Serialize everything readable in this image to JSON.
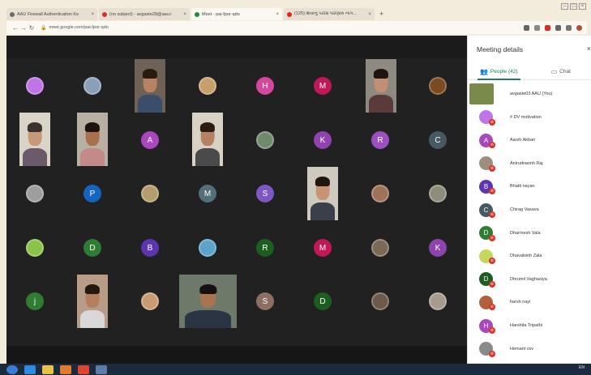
{
  "browser": {
    "tabs": [
      {
        "label": "AAU Firewall Authentication Ke",
        "icon": "globe-icon",
        "color": "#6b6b6b",
        "active": false
      },
      {
        "label": "(no subject) - avgaste28@aau.i",
        "icon": "gmail-icon",
        "color": "#d93025",
        "active": false
      },
      {
        "label": "Meet - pai-fpor-qdo",
        "icon": "meet-icon",
        "color": "#1e8e3e",
        "active": true
      },
      {
        "label": "(125) શિવાનુ પરીક્ષ પરિણામ નાગ...",
        "icon": "youtube-icon",
        "color": "#e62117",
        "active": false
      }
    ],
    "new_tab": "+",
    "window_controls": [
      "–",
      "□",
      "×"
    ],
    "url": "meet.google.com/pai-fpor-qdo"
  },
  "stage": {
    "avatars": [
      {
        "letter": "",
        "color": "#c074e6",
        "row": 0,
        "col": 0,
        "kind": "image"
      },
      {
        "letter": "",
        "color": "#8aa0b8",
        "row": 0,
        "col": 1,
        "kind": "image"
      },
      {
        "letter": "H",
        "color": "#d6479e",
        "row": 0,
        "col": 4
      },
      {
        "letter": "M",
        "color": "#c2185b",
        "row": 0,
        "col": 5
      },
      {
        "letter": "",
        "color": "#c8a06a",
        "row": 0,
        "col": 3,
        "kind": "image"
      },
      {
        "letter": "",
        "color": "#7b4a1f",
        "row": 0,
        "col": 7,
        "kind": "image"
      },
      {
        "letter": "A",
        "color": "#ab47bc",
        "row": 1,
        "col": 2
      },
      {
        "letter": "",
        "color": "#6f8a6c",
        "row": 1,
        "col": 4,
        "kind": "image"
      },
      {
        "letter": "K",
        "color": "#8e44ad",
        "row": 1,
        "col": 5
      },
      {
        "letter": "R",
        "color": "#9c4fbf",
        "row": 1,
        "col": 6
      },
      {
        "letter": "C",
        "color": "#455a64",
        "row": 1,
        "col": 7
      },
      {
        "letter": "",
        "color": "#9e9e9e",
        "row": 2,
        "col": 0,
        "kind": "image"
      },
      {
        "letter": "P",
        "color": "#1565c0",
        "row": 2,
        "col": 1
      },
      {
        "letter": "",
        "color": "#b59d6d",
        "row": 2,
        "col": 2,
        "kind": "image"
      },
      {
        "letter": "M",
        "color": "#546e7a",
        "row": 2,
        "col": 3
      },
      {
        "letter": "S",
        "color": "#7e57c2",
        "row": 2,
        "col": 4
      },
      {
        "letter": "",
        "color": "#a0725a",
        "row": 2,
        "col": 6,
        "kind": "image"
      },
      {
        "letter": "",
        "color": "#8d8d7a",
        "row": 2,
        "col": 7,
        "kind": "image"
      },
      {
        "letter": "",
        "color": "#8bc34a",
        "row": 3,
        "col": 0,
        "kind": "image"
      },
      {
        "letter": "D",
        "color": "#2e7d32",
        "row": 3,
        "col": 1
      },
      {
        "letter": "B",
        "color": "#5e35b1",
        "row": 3,
        "col": 2
      },
      {
        "letter": "",
        "color": "#5aa3c9",
        "row": 3,
        "col": 3,
        "kind": "image"
      },
      {
        "letter": "R",
        "color": "#1b5e20",
        "row": 3,
        "col": 4
      },
      {
        "letter": "M",
        "color": "#c2185b",
        "row": 3,
        "col": 5
      },
      {
        "letter": "",
        "color": "#7a6a55",
        "row": 3,
        "col": 6,
        "kind": "image"
      },
      {
        "letter": "K",
        "color": "#8e44ad",
        "row": 3,
        "col": 7
      },
      {
        "letter": "j",
        "color": "#2e7d32",
        "row": 4,
        "col": 0
      },
      {
        "letter": "",
        "color": "#c99b73",
        "row": 4,
        "col": 2,
        "kind": "image"
      },
      {
        "letter": "S",
        "color": "#8d6e63",
        "row": 4,
        "col": 4
      },
      {
        "letter": "D",
        "color": "#1b5e20",
        "row": 4,
        "col": 5
      },
      {
        "letter": "",
        "color": "#6e5a4a",
        "row": 4,
        "col": 6,
        "kind": "image"
      },
      {
        "letter": "",
        "color": "#a79b8c",
        "row": 4,
        "col": 7,
        "kind": "image"
      }
    ]
  },
  "panel": {
    "title": "Meeting details",
    "close": "×",
    "tabs": [
      {
        "label": "People (42)",
        "icon": "people-icon",
        "active": true
      },
      {
        "label": "Chat",
        "icon": "chat-icon",
        "active": false
      }
    ],
    "people": [
      {
        "name": "avgaste03 AAU (You)",
        "letter": "",
        "color": "#7a8a4a",
        "self": true
      },
      {
        "name": "# DV motivation",
        "letter": "",
        "color": "#c074e6"
      },
      {
        "name": "Aarsh Akbari",
        "letter": "A",
        "color": "#ab47bc"
      },
      {
        "name": "Anirudrasinh Raj",
        "letter": "",
        "color": "#9e8e7e"
      },
      {
        "name": "Bhatti nayan",
        "letter": "B",
        "color": "#5e35b1"
      },
      {
        "name": "Chirag Vasava",
        "letter": "C",
        "color": "#455a64"
      },
      {
        "name": "Dharmesh Vala",
        "letter": "D",
        "color": "#2e7d32"
      },
      {
        "name": "Dhavalsinh Zala",
        "letter": "",
        "color": "#c5d85a"
      },
      {
        "name": "Dhrumil Vaghasiya",
        "letter": "D",
        "color": "#1b5e20"
      },
      {
        "name": "harsh nayi",
        "letter": "",
        "color": "#b0603a"
      },
      {
        "name": "Harshita Tripathi",
        "letter": "H",
        "color": "#ab47bc"
      },
      {
        "name": "Hemant vsv",
        "letter": "",
        "color": "#8a8a8a"
      }
    ]
  },
  "taskbar": {
    "icons": [
      {
        "name": "start-icon",
        "color": "#3a7bd5"
      },
      {
        "name": "ie-icon",
        "color": "#2d8ce0"
      },
      {
        "name": "folder-icon",
        "color": "#e8c14a"
      },
      {
        "name": "media-icon",
        "color": "#e07b2d"
      },
      {
        "name": "chrome-icon",
        "color": "#e0452d"
      },
      {
        "name": "app-icon",
        "color": "#5a7ea8"
      }
    ],
    "tray": "EN"
  }
}
